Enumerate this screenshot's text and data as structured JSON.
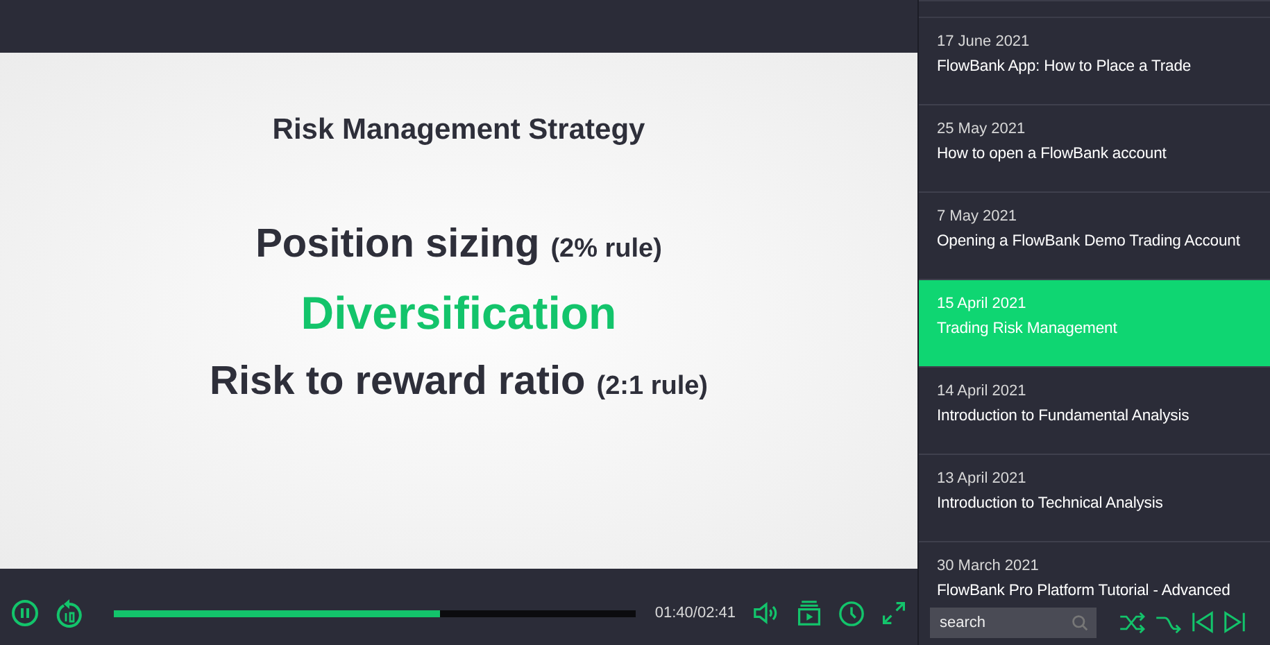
{
  "slide": {
    "title": "Risk Management Strategy",
    "lines": [
      {
        "kind": "normal",
        "text": "Position sizing",
        "note": "(2% rule)"
      },
      {
        "kind": "highlight",
        "text": "Diversification"
      },
      {
        "kind": "normal",
        "text": "Risk to reward ratio",
        "note": "(2:1 rule)"
      }
    ]
  },
  "player": {
    "progress": {
      "level": 0.625
    },
    "time": "01:40/02:41"
  },
  "playlist": {
    "items": [
      {
        "date": "17 June 2021",
        "title": "FlowBank App: How to Place a Trade",
        "selected": false
      },
      {
        "date": "25 May 2021",
        "title": "How to open a FlowBank account",
        "selected": false
      },
      {
        "date": "7 May 2021",
        "title": "Opening a FlowBank Demo Trading Account",
        "selected": false
      },
      {
        "date": "15 April 2021",
        "title": "Trading Risk Management",
        "selected": true
      },
      {
        "date": "14 April 2021",
        "title": "Introduction to Fundamental Analysis",
        "selected": false
      },
      {
        "date": "13 April 2021",
        "title": "Introduction to Technical Analysis",
        "selected": false
      },
      {
        "date": "30 March 2021",
        "title": "FlowBank Pro Platform Tutorial - Advanced",
        "selected": false
      }
    ],
    "search": {
      "placeholder": "search"
    }
  }
}
